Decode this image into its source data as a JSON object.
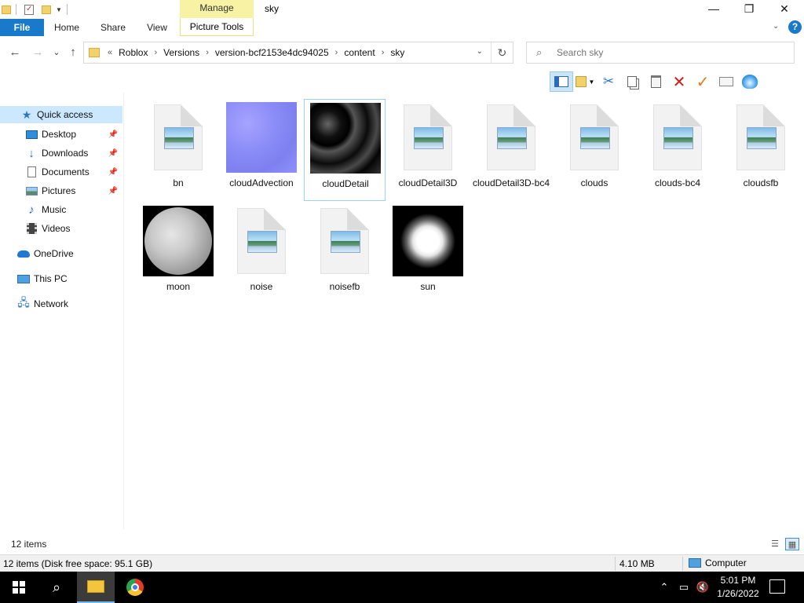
{
  "window": {
    "title": "sky",
    "context_tab_group": "Manage",
    "minimize": "—",
    "maximize": "❐",
    "close": "✕"
  },
  "ribbon": {
    "tabs": [
      "File",
      "Home",
      "Share",
      "View",
      "Picture Tools"
    ],
    "help": "?"
  },
  "navigation": {
    "back": "←",
    "forward": "→",
    "recent": "⌄",
    "up": "↑"
  },
  "address_bar": {
    "overflow": "«",
    "breadcrumbs": [
      "Roblox",
      "Versions",
      "version-bcf2153e4dc94025",
      "content",
      "sky"
    ]
  },
  "search": {
    "placeholder": "Search sky"
  },
  "nav_pane": {
    "items": [
      {
        "label": "Quick access",
        "icon": "star-icon",
        "selected": true
      },
      {
        "label": "Desktop",
        "icon": "desktop-icon",
        "pinned": true
      },
      {
        "label": "Downloads",
        "icon": "download-icon",
        "pinned": true
      },
      {
        "label": "Documents",
        "icon": "documents-icon",
        "pinned": true
      },
      {
        "label": "Pictures",
        "icon": "pictures-icon",
        "pinned": true
      },
      {
        "label": "Music",
        "icon": "music-icon"
      },
      {
        "label": "Videos",
        "icon": "videos-icon"
      },
      {
        "label": "OneDrive",
        "icon": "onedrive-icon"
      },
      {
        "label": "This PC",
        "icon": "computer-icon"
      },
      {
        "label": "Network",
        "icon": "network-icon"
      }
    ]
  },
  "files": [
    {
      "name": "bn",
      "thumb": "generic"
    },
    {
      "name": "cloudAdvection",
      "thumb": "advection"
    },
    {
      "name": "cloudDetail",
      "thumb": "cloud",
      "selected": true
    },
    {
      "name": "cloudDetail3D",
      "thumb": "generic"
    },
    {
      "name": "cloudDetail3D-bc4",
      "thumb": "generic"
    },
    {
      "name": "clouds",
      "thumb": "generic"
    },
    {
      "name": "clouds-bc4",
      "thumb": "generic"
    },
    {
      "name": "cloudsfb",
      "thumb": "generic"
    },
    {
      "name": "moon",
      "thumb": "moon"
    },
    {
      "name": "noise",
      "thumb": "generic"
    },
    {
      "name": "noisefb",
      "thumb": "generic"
    },
    {
      "name": "sun",
      "thumb": "sun"
    }
  ],
  "status": {
    "item_count": "12 items"
  },
  "details_bar": {
    "summary": "12 items (Disk free space: 95.1 GB)",
    "size": "4.10 MB",
    "location": "Computer"
  },
  "taskbar": {
    "time": "5:01 PM",
    "date": "1/26/2022"
  }
}
